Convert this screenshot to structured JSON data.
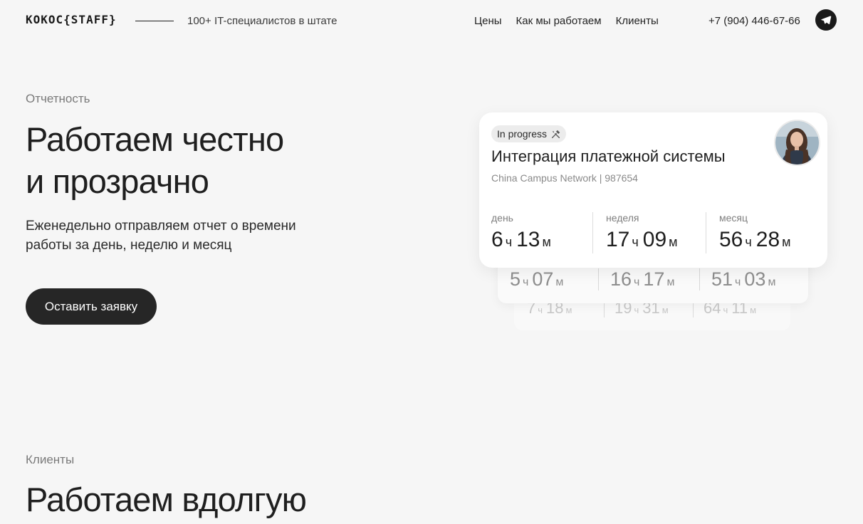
{
  "header": {
    "logo": "КОКОС{STAFF}",
    "tagline": "100+ IT-специалистов в штате",
    "nav": [
      "Цены",
      "Как мы работаем",
      "Клиенты"
    ],
    "phone": "+7 (904) 446-67-66",
    "telegram_icon": "telegram-icon"
  },
  "hero": {
    "eyebrow": "Отчетность",
    "title": "Работаем честно\nи прозрачно",
    "lead": "Еженедельно отправляем отчет о времени работы за день, неделю и месяц",
    "cta": "Оставить заявку"
  },
  "report_card": {
    "status": "In progress",
    "status_icon": "tools-icon",
    "title": "Интеграция платежной системы",
    "subtitle": "China Campus Network | 987654",
    "stats": [
      {
        "label": "день",
        "h": "6",
        "h_unit": "ч",
        "m": "13",
        "m_unit": "м"
      },
      {
        "label": "неделя",
        "h": "17",
        "h_unit": "ч",
        "m": "09",
        "m_unit": "м"
      },
      {
        "label": "месяц",
        "h": "56",
        "h_unit": "ч",
        "m": "28",
        "m_unit": "м"
      }
    ]
  },
  "stacked_cards": [
    [
      {
        "h": "5",
        "m": "07"
      },
      {
        "h": "16",
        "m": "17"
      },
      {
        "h": "51",
        "m": "03"
      }
    ],
    [
      {
        "h": "7",
        "m": "18"
      },
      {
        "h": "19",
        "m": "31"
      },
      {
        "h": "64",
        "m": "11"
      }
    ]
  ],
  "units": {
    "hour": "ч",
    "minute": "м"
  },
  "clients": {
    "eyebrow": "Клиенты",
    "title": "Работаем вдолгую"
  }
}
